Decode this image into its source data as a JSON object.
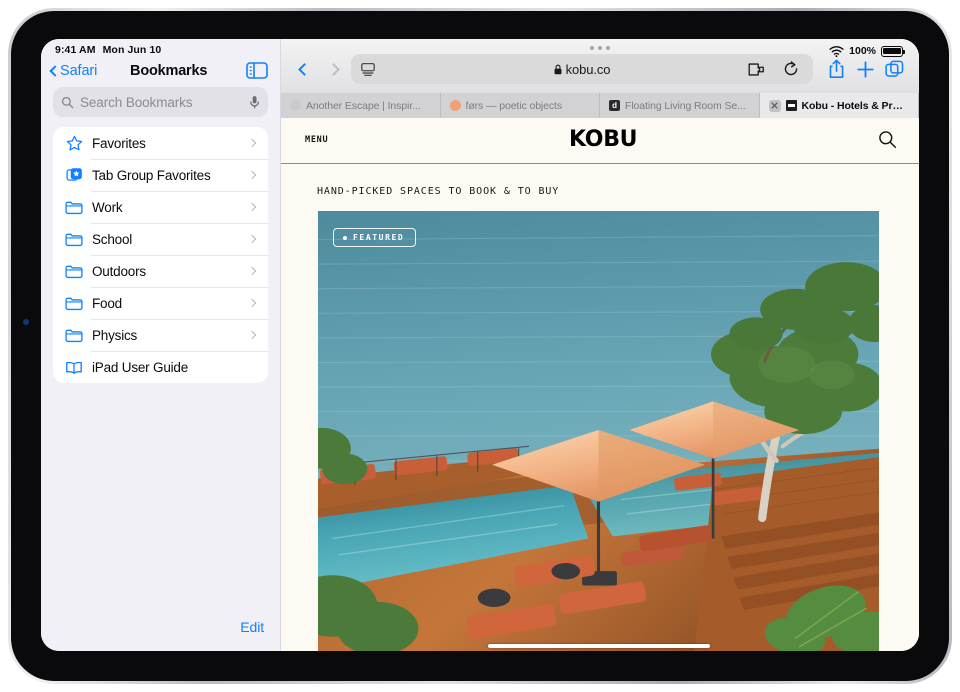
{
  "colors": {
    "ios_blue": "#1080ff",
    "sidebar_bg": "#f1f0f6",
    "page_bg": "#fdfaf3",
    "tab_active_bg": "#e9e9eb"
  },
  "status_bar": {
    "time": "9:41 AM",
    "date": "Mon Jun 10",
    "battery_percent": "100%",
    "wifi_icon": "wifi-icon",
    "battery_icon": "battery-icon"
  },
  "sidebar": {
    "back_label": "Safari",
    "back_icon": "chevron-left-icon",
    "title": "Bookmarks",
    "toggle_icon": "sidebar-toggle-icon",
    "search": {
      "placeholder": "Search Bookmarks",
      "search_icon": "search-icon",
      "mic_icon": "microphone-icon"
    },
    "items": [
      {
        "label": "Favorites",
        "icon": "star-icon",
        "chevron": true
      },
      {
        "label": "Tab Group Favorites",
        "icon": "tab-group-star-icon",
        "chevron": true
      },
      {
        "label": "Work",
        "icon": "folder-icon",
        "chevron": true
      },
      {
        "label": "School",
        "icon": "folder-icon",
        "chevron": true
      },
      {
        "label": "Outdoors",
        "icon": "folder-icon",
        "chevron": true
      },
      {
        "label": "Food",
        "icon": "folder-icon",
        "chevron": true
      },
      {
        "label": "Physics",
        "icon": "folder-icon",
        "chevron": true
      },
      {
        "label": "iPad User Guide",
        "icon": "book-icon",
        "chevron": false
      }
    ],
    "edit_label": "Edit"
  },
  "browser": {
    "grabber_icon": "multitasking-handle-icon",
    "back_icon": "chevron-left-icon",
    "forward_icon": "chevron-right-icon",
    "address": {
      "url": "kobu.co",
      "lock_icon": "lock-icon",
      "reader_icon": "reader-view-icon"
    },
    "extensions_icon": "extensions-icon",
    "reload_icon": "reload-icon",
    "share_icon": "share-icon",
    "new_tab_icon": "plus-icon",
    "tabs_overview_icon": "tabs-overview-icon",
    "tabs": [
      {
        "label": "Another Escape | Inspir...",
        "favicon": "globe-favicon",
        "active": false,
        "favicon_color": "#c9c9ce"
      },
      {
        "label": "førs — poetic objects",
        "favicon": "dot-favicon",
        "active": false,
        "favicon_color": "#f2a07a"
      },
      {
        "label": "Floating Living Room Se...",
        "favicon": "letter-d-favicon",
        "active": false,
        "favicon_color": "#2b2b2f"
      },
      {
        "label": "Kobu - Hotels & Propert...",
        "favicon": "kobu-favicon",
        "active": true,
        "favicon_color": "#1d1d1f",
        "close_icon": "close-icon"
      }
    ]
  },
  "web_page": {
    "menu_label": "MENU",
    "logo": "KOBU",
    "search_icon": "search-icon",
    "tagline": "HAND-PICKED SPACES TO BOOK & TO BUY",
    "hero": {
      "badge_label": "FEATURED",
      "badge_dot_icon": "dot-icon",
      "alt": "resort-infinity-pool-overlooking-ocean-with-orange-umbrellas-and-loungers"
    }
  },
  "home_indicator": "home-indicator"
}
